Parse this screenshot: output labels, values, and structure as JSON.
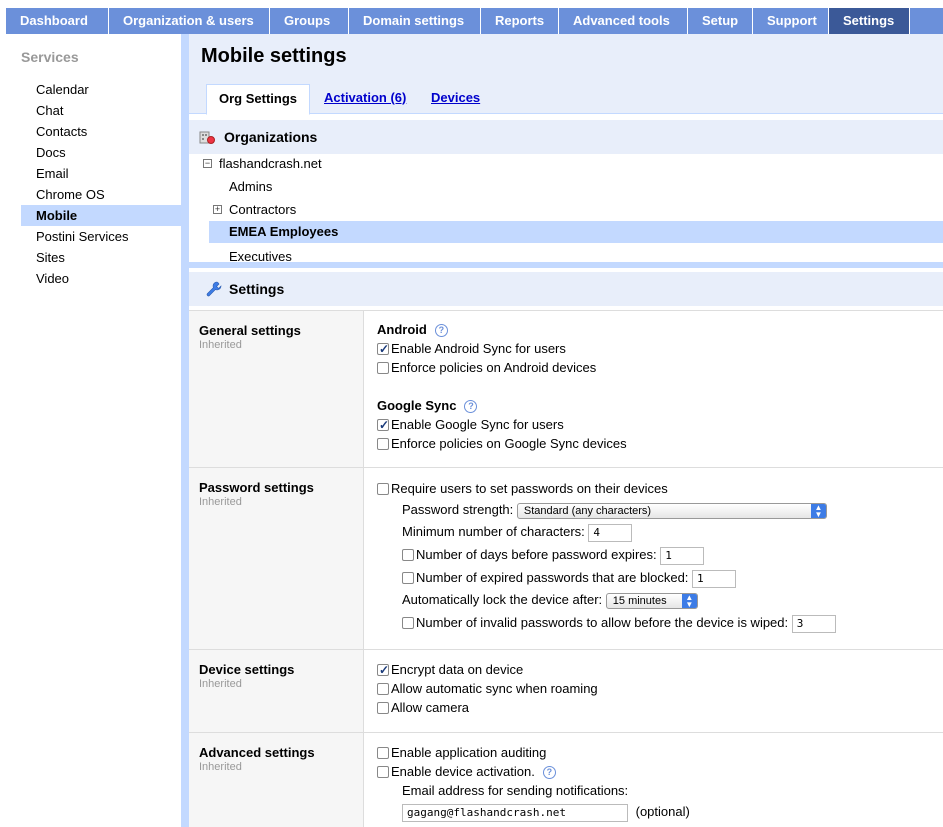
{
  "topnav": {
    "tabs": [
      {
        "label": "Dashboard"
      },
      {
        "label": "Organization & users"
      },
      {
        "label": "Groups"
      },
      {
        "label": "Domain settings"
      },
      {
        "label": "Reports"
      },
      {
        "label": "Advanced tools"
      },
      {
        "label": "Setup"
      },
      {
        "label": "Support"
      },
      {
        "label": "Settings"
      }
    ]
  },
  "sidebar": {
    "heading": "Services",
    "items": [
      {
        "label": "Calendar"
      },
      {
        "label": "Chat"
      },
      {
        "label": "Contacts"
      },
      {
        "label": "Docs"
      },
      {
        "label": "Email"
      },
      {
        "label": "Chrome OS"
      },
      {
        "label": "Mobile"
      },
      {
        "label": "Postini Services"
      },
      {
        "label": "Sites"
      },
      {
        "label": "Video"
      }
    ]
  },
  "page": {
    "title": "Mobile settings",
    "tabs": {
      "org": "Org Settings",
      "activation": "Activation (6)",
      "devices": "Devices"
    }
  },
  "orgs": {
    "heading": "Organizations",
    "root": "flashandcrash.net",
    "items": [
      "Admins",
      "Contractors",
      "EMEA Employees",
      "Executives"
    ]
  },
  "settings": {
    "heading": "Settings",
    "general": {
      "name": "General settings",
      "inherited": "Inherited",
      "android": "Android",
      "android_sync": "Enable Android Sync for users",
      "android_policies": "Enforce policies on Android devices",
      "google_sync": "Google Sync",
      "google_sync_enable": "Enable Google Sync for users",
      "google_sync_policies": "Enforce policies on Google Sync devices"
    },
    "password": {
      "name": "Password settings",
      "inherited": "Inherited",
      "require": "Require users to set passwords on their devices",
      "strength_label": "Password strength:",
      "strength_value": "Standard (any characters)",
      "min_chars_label": "Minimum number of characters:",
      "min_chars_value": "4",
      "expire_label": "Number of days before password expires:",
      "expire_value": "1",
      "blocked_label": "Number of expired passwords that are blocked:",
      "blocked_value": "1",
      "lock_label": "Automatically lock the device after:",
      "lock_value": "15 minutes",
      "wipe_label": "Number of invalid passwords to allow before the device is wiped:",
      "wipe_value": "3"
    },
    "device": {
      "name": "Device settings",
      "inherited": "Inherited",
      "encrypt": "Encrypt data on device",
      "roaming": "Allow automatic sync when roaming",
      "camera": "Allow camera"
    },
    "advanced": {
      "name": "Advanced settings",
      "inherited": "Inherited",
      "auditing": "Enable application auditing",
      "activation": "Enable device activation.",
      "email_label": "Email address for sending notifications:",
      "email_value": "gagang@flashandcrash.net",
      "optional": "(optional)"
    }
  }
}
